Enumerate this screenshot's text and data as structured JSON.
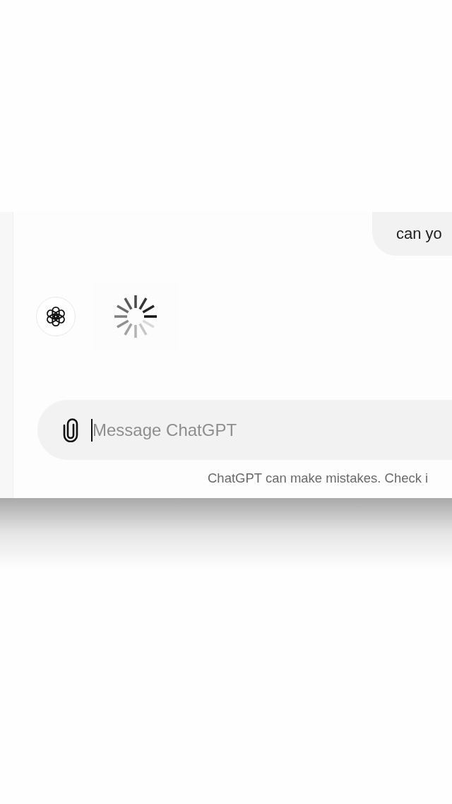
{
  "messages": [
    {
      "kind": "user",
      "text": "can yo"
    },
    {
      "kind": "assistant_loading"
    }
  ],
  "composer": {
    "placeholder": "Message ChatGPT"
  },
  "disclaimer": "ChatGPT can make mistakes. Check i"
}
